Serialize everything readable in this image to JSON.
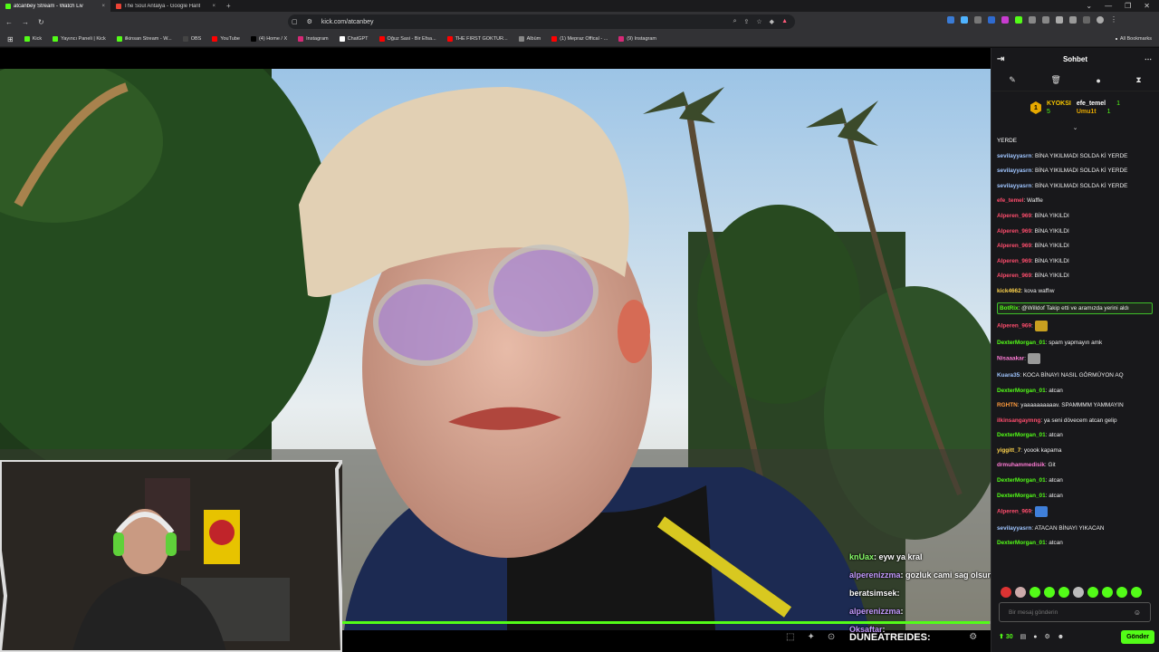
{
  "browser": {
    "tabs": [
      {
        "title": "atcanbey Stream - Watch Liv",
        "active": true,
        "favicon_color": "#53fc18"
      },
      {
        "title": "The Soul Antalya - Google Harit",
        "active": false,
        "favicon_color": "#ea4335"
      }
    ],
    "url": "kick.com/atcanbey",
    "bookmarks": [
      {
        "label": "Kick",
        "color": "#53fc18"
      },
      {
        "label": "Yayıncı Paneli | Kick",
        "color": "#53fc18"
      },
      {
        "label": "ilkinsan Stream - W...",
        "color": "#53fc18"
      },
      {
        "label": "OBS",
        "color": "#444444"
      },
      {
        "label": "YouTube",
        "color": "#ff0000"
      },
      {
        "label": "(4) Home / X",
        "color": "#000000"
      },
      {
        "label": "Instagram",
        "color": "#d62976"
      },
      {
        "label": "ChatGPT",
        "color": "#ffffff"
      },
      {
        "label": "Oğuz Sasi - Bir Efsa...",
        "color": "#ff0000"
      },
      {
        "label": "THE FIRST GOKTUR...",
        "color": "#ff0000"
      },
      {
        "label": "Albüm",
        "color": "#888888"
      },
      {
        "label": "(1) Mepraz Offical - ...",
        "color": "#ff0000"
      },
      {
        "label": "(9) Instagram",
        "color": "#d62976"
      }
    ],
    "all_bookmarks": "All Bookmarks"
  },
  "chat": {
    "header": "Sohbet",
    "leaderboard": {
      "top_name": "KYOKSI",
      "top_count": "5",
      "top_rank": "1",
      "rows": [
        {
          "name": "efe_temel",
          "count": "1"
        },
        {
          "name": "Umu1t",
          "count": "1"
        }
      ]
    },
    "messages": [
      {
        "user": "",
        "text": "YERDE",
        "color": "#ffffff"
      },
      {
        "user": "sevilayyasrn",
        "text": ": BİNA YIKILMADI SOLDA Kİ YERDE",
        "color": "#9fc5ff"
      },
      {
        "user": "sevilayyasrn",
        "text": ": BİNA YIKILMADI SOLDA Kİ YERDE",
        "color": "#9fc5ff"
      },
      {
        "user": "sevilayyasrn",
        "text": ": BİNA YIKILMADI SOLDA Kİ YERDE",
        "color": "#9fc5ff"
      },
      {
        "user": "efe_temel",
        "text": ": Waffle",
        "color": "#ff4d6d"
      },
      {
        "user": "Alperen_969",
        "text": ": BİNA YIKILDI",
        "color": "#ff4d6d"
      },
      {
        "user": "Alperen_969",
        "text": ": BİNA YIKILDI",
        "color": "#ff4d6d"
      },
      {
        "user": "Alperen_969",
        "text": ": BİNA YIKILDI",
        "color": "#ff4d6d"
      },
      {
        "user": "Alperen_969",
        "text": ": BİNA YIKILDI",
        "color": "#ff4d6d"
      },
      {
        "user": "Alperen_969",
        "text": ": BİNA YIKILDI",
        "color": "#ff4d6d"
      },
      {
        "user": "kick4662",
        "text": ": kova waffıw",
        "color": "#ffd44d"
      },
      {
        "user": "BotRix",
        "text": ": @Willdof Takip etti ve aramızda yerini aldı",
        "color": "#53fc18",
        "bot": true
      },
      {
        "user": "Alperen_969",
        "text": ":",
        "color": "#ff4d6d",
        "emote": "#c8a020"
      },
      {
        "user": "DexterMorgan_01",
        "text": ": spam yapmayın amk",
        "color": "#53fc18"
      },
      {
        "user": "Nisaaakar",
        "text": ":",
        "color": "#ff7bd5",
        "emote": "#999999"
      },
      {
        "user": "Kuara35",
        "text": ": KOCA BİNAYI NASIL GÖRMÜYON AQ",
        "color": "#9fc5ff"
      },
      {
        "user": "DexterMorgan_01",
        "text": ": atcan",
        "color": "#53fc18"
      },
      {
        "user": "RGHTN",
        "text": ": yaaaaaaaaaav. SPAMMMM YAMMAYIN",
        "color": "#ff9b3d"
      },
      {
        "user": "ilkinsangaymng",
        "text": ": ya seni dövecem atcan gelip",
        "color": "#ff4d6d"
      },
      {
        "user": "DexterMorgan_01",
        "text": ": atcan",
        "color": "#53fc18"
      },
      {
        "user": "yiggitt_7",
        "text": ": yoook kapama",
        "color": "#ffd44d"
      },
      {
        "user": "drmuhammedisik",
        "text": ": Git",
        "color": "#ff7bd5"
      },
      {
        "user": "DexterMorgan_01",
        "text": ": atcan",
        "color": "#53fc18"
      },
      {
        "user": "DexterMorgan_01",
        "text": ": atcan",
        "color": "#53fc18"
      },
      {
        "user": "Alperen_969",
        "text": ":",
        "color": "#ff4d6d",
        "emote": "#3f7fd9"
      },
      {
        "user": "sevilayyasrn",
        "text": ": ATACAN BİNAYI YIKACAN",
        "color": "#9fc5ff"
      },
      {
        "user": "DexterMorgan_01",
        "text": ": atcan",
        "color": "#53fc18"
      }
    ],
    "input_placeholder": "Bir mesaj gönderin",
    "points": "30",
    "send_label": "Gönder"
  },
  "overlay": {
    "lines": [
      {
        "name": "knUax",
        "text": ": eyw ya kral",
        "cls": "ovl-name"
      },
      {
        "name": "alperenizzma",
        "text": ": gozluk cami sag olsun",
        "cls": "ovl-name2"
      },
      {
        "name": "beratsimsek",
        "text": ":",
        "cls": "ovl-name3"
      },
      {
        "name": "alperenizzma",
        "text": ":",
        "cls": "ovl-name2"
      },
      {
        "name": "Oksaftar",
        "text": ":",
        "cls": "ovl-name2"
      }
    ],
    "bottom_name": "DUNEATREIDES:"
  },
  "player": {
    "progress": 0.999
  }
}
